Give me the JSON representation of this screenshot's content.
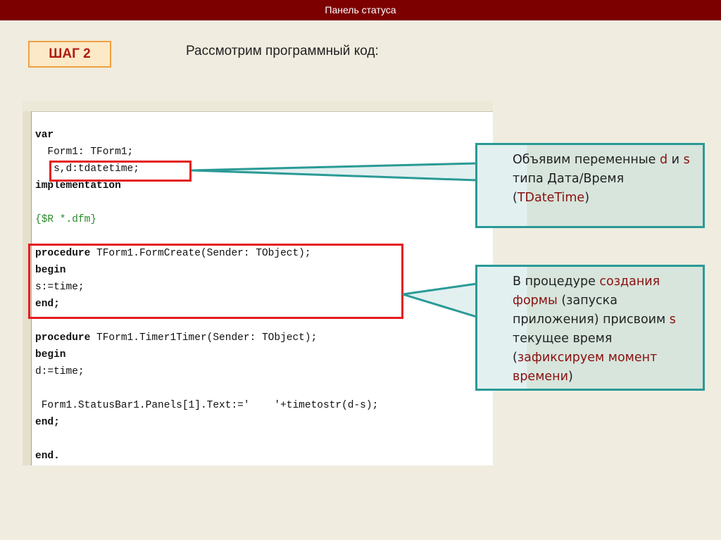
{
  "header": {
    "title": "Панель статуса"
  },
  "step": {
    "label": "ШАГ 2"
  },
  "heading": "Рассмотрим программный код:",
  "code": {
    "lines": [
      {
        "kw": "var",
        "rest": ""
      },
      {
        "kw": "",
        "rest": "  Form1: TForm1;"
      },
      {
        "kw": "",
        "rest": "   s,d:tdatetime;"
      },
      {
        "kw": "implementation",
        "rest": ""
      },
      {
        "kw": "",
        "rest": "",
        "comment": "{$R *.dfm}"
      },
      {
        "kw": "procedure",
        "rest": " TForm1.FormCreate(Sender: TObject);"
      },
      {
        "kw": "begin",
        "rest": ""
      },
      {
        "kw": "",
        "rest": "s:=time;"
      },
      {
        "kw": "end;",
        "rest": ""
      },
      {
        "kw": "procedure",
        "rest": " TForm1.Timer1Timer(Sender: TObject);"
      },
      {
        "kw": "begin",
        "rest": ""
      },
      {
        "kw": "",
        "rest": "d:=time;"
      },
      {
        "kw": "",
        "rest": " Form1.StatusBar1.Panels[1].Text:='    '+timetostr(d-s);"
      },
      {
        "kw": "end;",
        "rest": ""
      },
      {
        "kw": "end.",
        "rest": ""
      }
    ]
  },
  "callouts": [
    {
      "segments": [
        {
          "t": "Объявим переменные ",
          "hl": false
        },
        {
          "t": "d",
          "hl": true
        },
        {
          "t": " и ",
          "hl": false
        },
        {
          "t": "s",
          "hl": true
        },
        {
          "t": " типа Дата/Время (",
          "hl": false
        },
        {
          "t": "TDateTime",
          "hl": true
        },
        {
          "t": ")",
          "hl": false
        }
      ]
    },
    {
      "segments": [
        {
          "t": "В процедуре ",
          "hl": false
        },
        {
          "t": "создания формы",
          "hl": true
        },
        {
          "t": " (запуска приложения) присвоим ",
          "hl": false
        },
        {
          "t": "s",
          "hl": true
        },
        {
          "t": " текущее время (",
          "hl": false
        },
        {
          "t": "зафиксируем момент времени",
          "hl": true
        },
        {
          "t": ")",
          "hl": false
        }
      ]
    }
  ],
  "colors": {
    "topbar": "#7c0000",
    "highlight": "#8a1010",
    "callout_border": "#2a9a96",
    "code_box": "#e41c1c"
  }
}
